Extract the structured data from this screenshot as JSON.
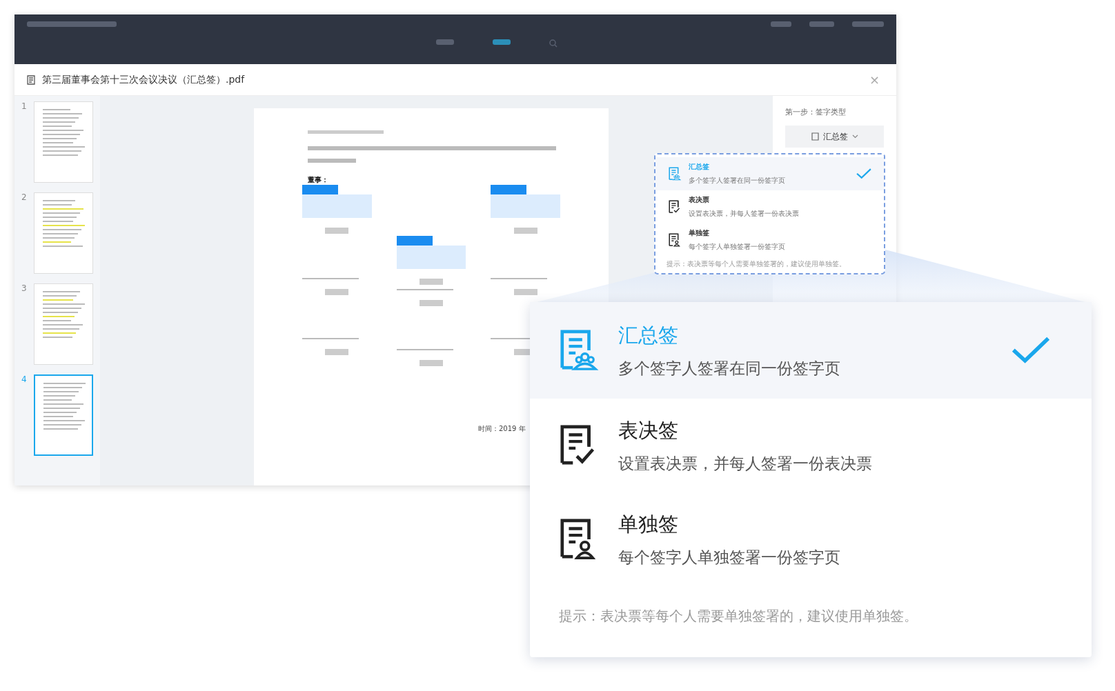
{
  "document_tab": {
    "title": "第三届董事会第十三次会议决议（汇总签）.pdf",
    "close": "×"
  },
  "thumbnails": [
    {
      "number": "1",
      "selected": false
    },
    {
      "number": "2",
      "selected": false
    },
    {
      "number": "3",
      "selected": false
    },
    {
      "number": "4",
      "selected": true
    }
  ],
  "page": {
    "directors_label": "董事：",
    "date_text": "时间：2019 年"
  },
  "side_panel": {
    "step_label": "第一步：签字类型",
    "dropdown_value": "汇总签"
  },
  "mini_dropdown": {
    "options": [
      {
        "kind": "group",
        "title": "汇总签",
        "description": "多个签字人签署在同一份签字页",
        "selected": true
      },
      {
        "kind": "vote",
        "title": "表决票",
        "description": "设置表决票，并每人签署一份表决票",
        "selected": false
      },
      {
        "kind": "single",
        "title": "单独签",
        "description": "每个签字人单独签署一份签字页",
        "selected": false
      }
    ],
    "hint": "提示：表决票等每个人需要单独签署的，建议使用单独签。"
  },
  "zoomed_dropdown": {
    "options": [
      {
        "kind": "group",
        "title": "汇总签",
        "description": "多个签字人签署在同一份签字页",
        "selected": true
      },
      {
        "kind": "vote",
        "title": "表决签",
        "description": "设置表决票，并每人签署一份表决票",
        "selected": false
      },
      {
        "kind": "single",
        "title": "单独签",
        "description": "每个签字人单独签署一份签字页",
        "selected": false
      }
    ],
    "hint": "提示：表决票等每个人需要单独签署的，建议使用单独签。"
  }
}
